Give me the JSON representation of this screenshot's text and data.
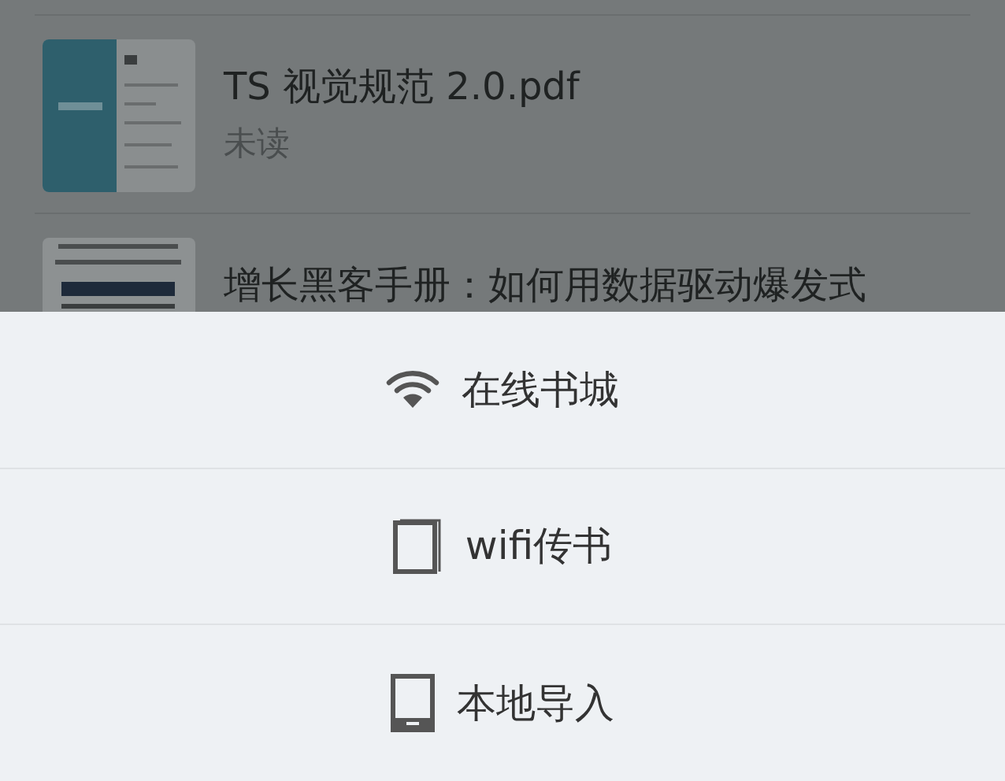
{
  "files": [
    {
      "title": "TS 视觉规范 2.0.pdf",
      "status": "未读"
    },
    {
      "title": "增长黑客手册：如何用数据驱动爆发式"
    }
  ],
  "sheet": {
    "items": [
      {
        "kind": "wifi",
        "label": "在线书城"
      },
      {
        "kind": "book",
        "label": "wifi传书"
      },
      {
        "kind": "tablet",
        "label": "本地导入"
      }
    ]
  }
}
